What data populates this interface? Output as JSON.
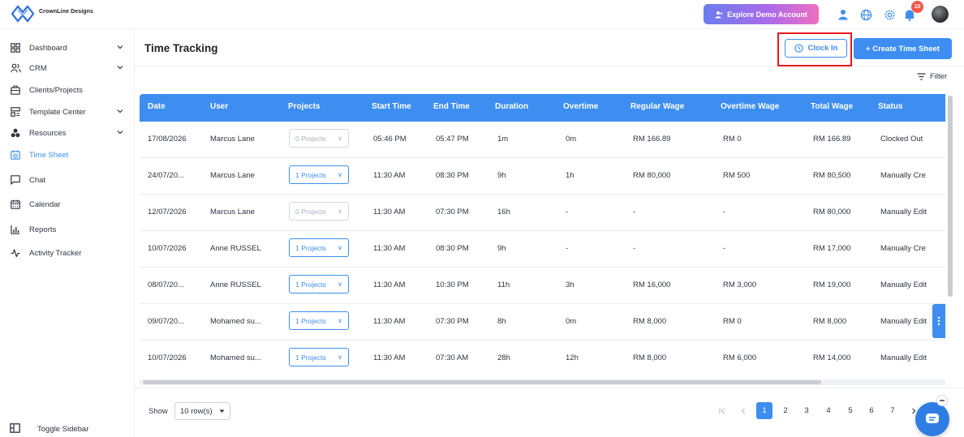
{
  "brand": {
    "name": "CrownLine Designs",
    "logo_icon": "crown-logo-icon"
  },
  "topbar": {
    "demo_button": "Explore Demo Account",
    "notification_count": "10",
    "icons": [
      "user-icon",
      "globe-icon",
      "gear-icon",
      "bell-icon",
      "avatar"
    ]
  },
  "sidebar": {
    "items": [
      {
        "label": "Dashboard",
        "icon": "dashboard-icon",
        "has_chevron": true
      },
      {
        "label": "CRM",
        "icon": "users-icon",
        "has_chevron": true
      },
      {
        "label": "Clients/Projects",
        "icon": "briefcase-icon",
        "has_chevron": false
      },
      {
        "label": "Template Center",
        "icon": "template-icon",
        "has_chevron": true
      },
      {
        "label": "Resources",
        "icon": "resources-icon",
        "has_chevron": true
      },
      {
        "label": "Time Sheet",
        "icon": "calendar-clock-icon",
        "has_chevron": false,
        "active": true
      },
      {
        "label": "Chat",
        "icon": "chat-icon",
        "has_chevron": false
      },
      {
        "label": "Calendar",
        "icon": "calendar-icon",
        "has_chevron": false
      },
      {
        "label": "Reports",
        "icon": "bar-chart-icon",
        "has_chevron": false
      },
      {
        "label": "Activity Tracker",
        "icon": "activity-icon",
        "has_chevron": false
      }
    ],
    "toggle_label": "Toggle Sidebar"
  },
  "main": {
    "title": "Time Tracking",
    "clock_in_label": "Clock In",
    "create_label": "+ Create Time Sheet",
    "filter_label": "Filter"
  },
  "table": {
    "columns": [
      "Date",
      "User",
      "Projects",
      "Start Time",
      "End Time",
      "Duration",
      "Overtime",
      "Regular Wage",
      "Overtime Wage",
      "Total Wage",
      "Status"
    ],
    "rows": [
      {
        "date": "17/08/2026",
        "user": "Marcus Lane",
        "projects": "0 Projects",
        "projects_disabled": true,
        "start": "05:46 PM",
        "end": "05:47 PM",
        "duration": "1m",
        "overtime": "0m",
        "regular": "RM 166.89",
        "ot_wage": "RM 0",
        "total": "RM 166.89",
        "status": "Clocked Out"
      },
      {
        "date": "24/07/20...",
        "user": "Marcus Lane",
        "projects": "1 Projects",
        "projects_disabled": false,
        "start": "11:30 AM",
        "end": "08:30 PM",
        "duration": "9h",
        "overtime": "1h",
        "regular": "RM 80,000",
        "ot_wage": "RM 500",
        "total": "RM 80,500",
        "status": "Manually Cre"
      },
      {
        "date": "12/07/2026",
        "user": "Marcus Lane",
        "projects": "0 Projects",
        "projects_disabled": true,
        "start": "11:30 AM",
        "end": "07:30 PM",
        "duration": "16h",
        "overtime": "-",
        "regular": "-",
        "ot_wage": "-",
        "total": "RM 80,000",
        "status": "Manually Edit"
      },
      {
        "date": "10/07/2026",
        "user": "Anne RUSSEL",
        "projects": "1 Projects",
        "projects_disabled": false,
        "start": "11:30 AM",
        "end": "08:30 PM",
        "duration": "9h",
        "overtime": "-",
        "regular": "-",
        "ot_wage": "-",
        "total": "RM 17,000",
        "status": "Manually Cre"
      },
      {
        "date": "08/07/20...",
        "user": "Anne RUSSEL",
        "projects": "1 Projects",
        "projects_disabled": false,
        "start": "11:30 AM",
        "end": "10:30 PM",
        "duration": "11h",
        "overtime": "3h",
        "regular": "RM 16,000",
        "ot_wage": "RM 3,000",
        "total": "RM 19,000",
        "status": "Manually Edit"
      },
      {
        "date": "09/07/20...",
        "user": "Mohamed su...",
        "projects": "1 Projects",
        "projects_disabled": false,
        "start": "11:30 AM",
        "end": "07:30 PM",
        "duration": "8h",
        "overtime": "0m",
        "regular": "RM 8,000",
        "ot_wage": "RM 0",
        "total": "RM 8,000",
        "status": "Manually Edit"
      },
      {
        "date": "10/07/2026",
        "user": "Mohamed su...",
        "projects": "1 Projects",
        "projects_disabled": false,
        "start": "11:30 AM",
        "end": "07:30 AM",
        "duration": "28h",
        "overtime": "12h",
        "regular": "RM 8,000",
        "ot_wage": "RM 6,000",
        "total": "RM 14,000",
        "status": "Manually Edit"
      }
    ]
  },
  "pagination": {
    "show_label": "Show",
    "rows_per_page": "10 row(s)",
    "pages": [
      "1",
      "2",
      "3",
      "4",
      "5",
      "6",
      "7"
    ],
    "current_page": "1"
  },
  "colors": {
    "accent": "#3d8ef0",
    "highlight": "#e61b1b",
    "badge": "#f4574a"
  }
}
